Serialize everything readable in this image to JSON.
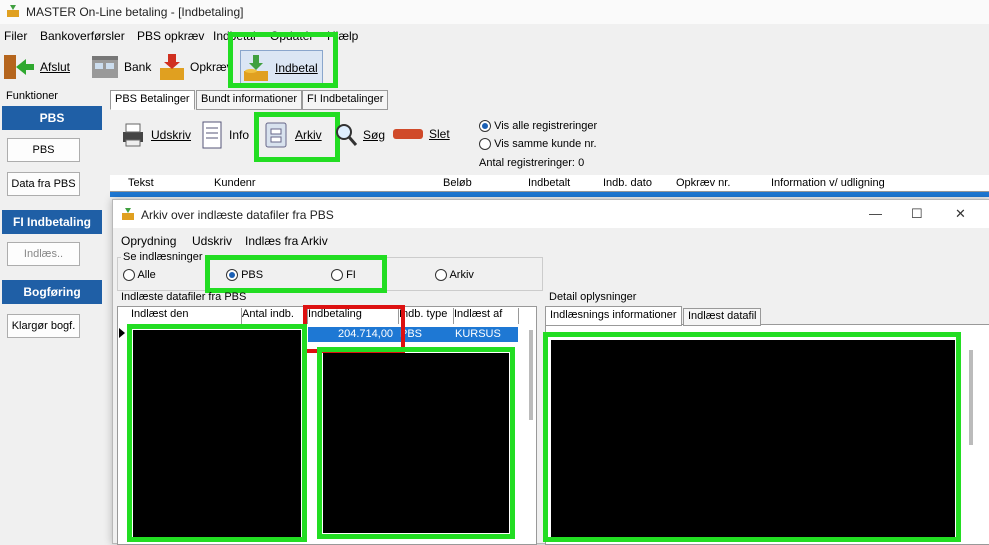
{
  "window": {
    "title": "MASTER On-Line betaling - [Indbetaling]"
  },
  "menu": [
    "Filer",
    "Bankoverførsler",
    "PBS opkræv",
    "Indbetal",
    "Opdatér",
    "Hjælp"
  ],
  "toolbar": {
    "afslut": "Afslut",
    "bank": "Bank",
    "opkraev": "Opkræv",
    "indbetal": "Indbetal"
  },
  "sidebar": {
    "heading": "Funktioner",
    "pbs_group": "PBS",
    "pbs_btn": "PBS",
    "data_fra_pbs": "Data fra PBS",
    "fi_group": "FI Indbetaling",
    "indlaes": "Indlæs..",
    "bogforing_group": "Bogføring",
    "klargor": "Klargør bogf."
  },
  "tabs": [
    "PBS Betalinger",
    "Bundt informationer",
    "FI Indbetalinger"
  ],
  "subtoolbar": {
    "udskriv": "Udskriv",
    "info": "Info",
    "arkiv": "Arkiv",
    "sog": "Søg",
    "slet": "Slet"
  },
  "filter": {
    "vis_alle": "Vis alle registreringer",
    "vis_samme": "Vis samme kunde nr.",
    "antal_label": "Antal registreringer:",
    "antal_value": "0"
  },
  "grid_columns": [
    "Tekst",
    "Kundenr",
    "Beløb",
    "Indbetalt",
    "Indb. dato",
    "Opkræv nr.",
    "Information v/ udligning"
  ],
  "dialog": {
    "title": "Arkiv over indlæste datafiler fra PBS",
    "menu": [
      "Oprydning",
      "Udskriv",
      "Indlæs fra Arkiv"
    ],
    "se_label": "Se indlæsninger",
    "radios": [
      "Alle",
      "PBS",
      "FI",
      "Arkiv"
    ],
    "selected_radio": "PBS",
    "files_label": "Indlæste datafiler fra PBS",
    "columns": [
      "Indlæst den",
      "Antal indb.",
      "Indbetaling",
      "Indb. type",
      "Indlæst af"
    ],
    "row": {
      "indbetaling": "204.714,00",
      "type": "PBS",
      "af": "KURSUS"
    },
    "detail_label": "Detail oplysninger",
    "detail_tabs": [
      "Indlæsnings informationer",
      "Indlæst datafil"
    ]
  },
  "colors": {
    "accent_green": "#22dd22",
    "accent_red": "#dd1111",
    "group_blue": "#1f5fa6",
    "selection_blue": "#1e78d4"
  }
}
